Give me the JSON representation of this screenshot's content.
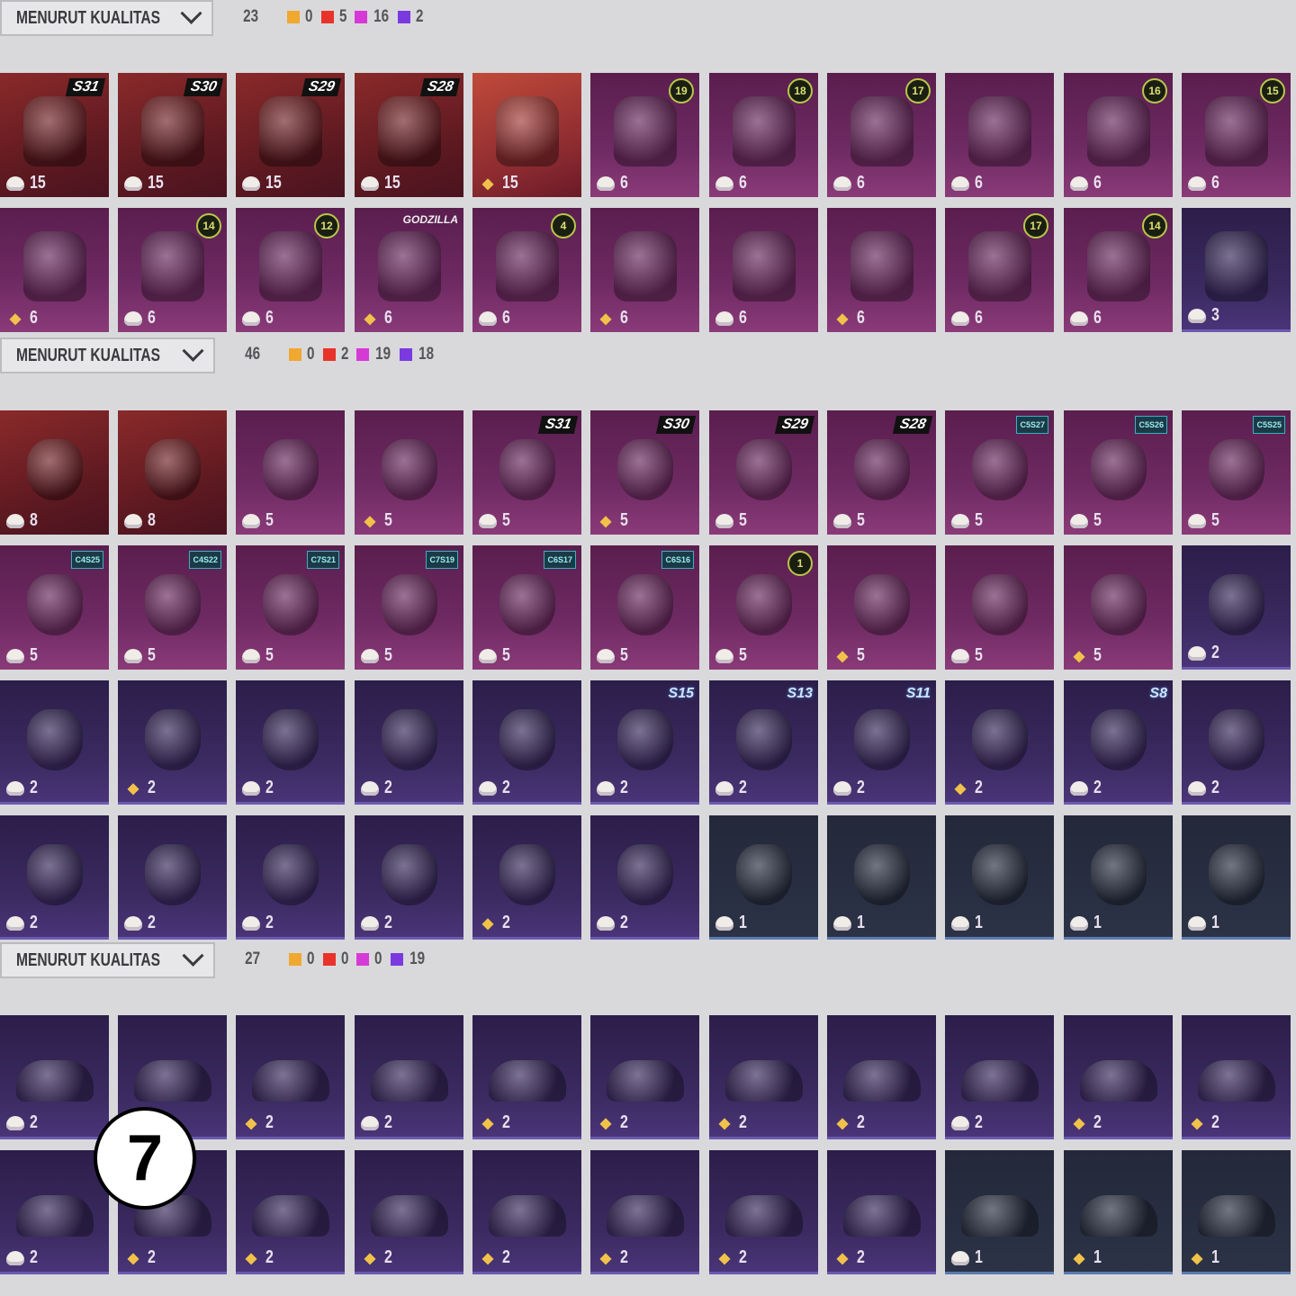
{
  "sections": [
    {
      "sort_label": "MENURUT KUALITAS",
      "total": "23",
      "qualities": [
        {
          "color": "#f0a830",
          "count": "0"
        },
        {
          "color": "#e8332a",
          "count": "5"
        },
        {
          "color": "#d63ad6",
          "count": "16"
        },
        {
          "color": "#7a3ae0",
          "count": "2"
        }
      ],
      "type": "bag",
      "rows": [
        [
          {
            "tone": "red",
            "badge": "S31",
            "btype": "season",
            "icon": "cloud-coin",
            "cost": "15"
          },
          {
            "tone": "red",
            "badge": "S30",
            "btype": "season",
            "icon": "cloud-coin",
            "cost": "15"
          },
          {
            "tone": "red",
            "badge": "S29",
            "btype": "season",
            "icon": "cloud-coin",
            "cost": "15"
          },
          {
            "tone": "red",
            "badge": "S28",
            "btype": "season",
            "icon": "cloud-coin",
            "cost": "15"
          },
          {
            "tone": "redhi",
            "badge": "",
            "btype": "",
            "icon": "gold-coin",
            "cost": "15"
          },
          {
            "tone": "pink",
            "badge": "19",
            "btype": "round",
            "icon": "cloud-coin",
            "cost": "6"
          },
          {
            "tone": "pink",
            "badge": "18",
            "btype": "round",
            "icon": "cloud-coin",
            "cost": "6"
          },
          {
            "tone": "pink",
            "badge": "17",
            "btype": "round",
            "icon": "cloud-coin",
            "cost": "6"
          },
          {
            "tone": "pink",
            "badge": "",
            "btype": "",
            "icon": "cloud-coin",
            "cost": "6"
          },
          {
            "tone": "pink",
            "badge": "16",
            "btype": "round",
            "icon": "cloud-coin",
            "cost": "6"
          },
          {
            "tone": "pink",
            "badge": "15",
            "btype": "round",
            "icon": "cloud-coin",
            "cost": "6"
          }
        ],
        [
          {
            "tone": "pink",
            "badge": "",
            "btype": "",
            "icon": "gold-coin",
            "cost": "6"
          },
          {
            "tone": "pink",
            "badge": "14",
            "btype": "round",
            "icon": "cloud-coin",
            "cost": "6"
          },
          {
            "tone": "pink",
            "badge": "12",
            "btype": "round",
            "icon": "cloud-coin",
            "cost": "6"
          },
          {
            "tone": "pink",
            "badge": "GODZILLA",
            "btype": "text",
            "icon": "gold-coin",
            "cost": "6"
          },
          {
            "tone": "pink",
            "badge": "4",
            "btype": "round",
            "icon": "cloud-coin",
            "cost": "6"
          },
          {
            "tone": "pink",
            "badge": "",
            "btype": "",
            "icon": "gold-coin",
            "cost": "6"
          },
          {
            "tone": "pink",
            "badge": "",
            "btype": "",
            "icon": "cloud-coin",
            "cost": "6"
          },
          {
            "tone": "pink",
            "badge": "",
            "btype": "",
            "icon": "gold-coin",
            "cost": "6"
          },
          {
            "tone": "pink",
            "badge": "17",
            "btype": "round",
            "icon": "cloud-coin",
            "cost": "6"
          },
          {
            "tone": "pink",
            "badge": "14",
            "btype": "round",
            "icon": "cloud-coin",
            "cost": "6"
          },
          {
            "tone": "purple",
            "badge": "",
            "btype": "",
            "icon": "cloud-coin",
            "cost": "3"
          }
        ]
      ]
    },
    {
      "sort_label": "MENURUT KUALITAS",
      "total": "46",
      "qualities": [
        {
          "color": "#f0a830",
          "count": "0"
        },
        {
          "color": "#e8332a",
          "count": "2"
        },
        {
          "color": "#d63ad6",
          "count": "19"
        },
        {
          "color": "#7a3ae0",
          "count": "18"
        }
      ],
      "type": "mask",
      "rows": [
        [
          {
            "tone": "red",
            "badge": "",
            "btype": "",
            "icon": "cloud-coin",
            "cost": "8"
          },
          {
            "tone": "red",
            "badge": "",
            "btype": "",
            "icon": "cloud-coin",
            "cost": "8"
          },
          {
            "tone": "pink",
            "badge": "",
            "btype": "",
            "icon": "cloud-coin",
            "cost": "5"
          },
          {
            "tone": "pink",
            "badge": "",
            "btype": "",
            "icon": "gold-coin",
            "cost": "5"
          },
          {
            "tone": "pink",
            "badge": "S31",
            "btype": "season",
            "icon": "cloud-coin",
            "cost": "5"
          },
          {
            "tone": "pink",
            "badge": "S30",
            "btype": "season",
            "icon": "gold-coin",
            "cost": "5"
          },
          {
            "tone": "pink",
            "badge": "S29",
            "btype": "season",
            "icon": "cloud-coin",
            "cost": "5"
          },
          {
            "tone": "pink",
            "badge": "S28",
            "btype": "season",
            "icon": "cloud-coin",
            "cost": "5"
          },
          {
            "tone": "pink",
            "badge": "C5S27",
            "btype": "hex",
            "icon": "cloud-coin",
            "cost": "5"
          },
          {
            "tone": "pink",
            "badge": "C5S26",
            "btype": "hex",
            "icon": "cloud-coin",
            "cost": "5"
          },
          {
            "tone": "pink",
            "badge": "C5S25",
            "btype": "hex",
            "icon": "cloud-coin",
            "cost": "5"
          }
        ],
        [
          {
            "tone": "pink",
            "badge": "C4S25",
            "btype": "hex",
            "icon": "cloud-coin",
            "cost": "5"
          },
          {
            "tone": "pink",
            "badge": "C4S22",
            "btype": "hex",
            "icon": "cloud-coin",
            "cost": "5"
          },
          {
            "tone": "pink",
            "badge": "C7S21",
            "btype": "hex",
            "icon": "cloud-coin",
            "cost": "5"
          },
          {
            "tone": "pink",
            "badge": "C7S19",
            "btype": "hex",
            "icon": "cloud-coin",
            "cost": "5"
          },
          {
            "tone": "pink",
            "badge": "C6S17",
            "btype": "hex",
            "icon": "cloud-coin",
            "cost": "5"
          },
          {
            "tone": "pink",
            "badge": "C6S16",
            "btype": "hex",
            "icon": "cloud-coin",
            "cost": "5"
          },
          {
            "tone": "pink",
            "badge": "1",
            "btype": "round",
            "icon": "cloud-coin",
            "cost": "5"
          },
          {
            "tone": "pink",
            "badge": "",
            "btype": "",
            "icon": "gold-coin",
            "cost": "5"
          },
          {
            "tone": "pink",
            "badge": "",
            "btype": "",
            "icon": "cloud-coin",
            "cost": "5"
          },
          {
            "tone": "pink",
            "badge": "",
            "btype": "",
            "icon": "gold-coin",
            "cost": "5"
          },
          {
            "tone": "purple",
            "badge": "",
            "btype": "",
            "icon": "cloud-coin",
            "cost": "2"
          }
        ],
        [
          {
            "tone": "purple",
            "badge": "",
            "btype": "",
            "icon": "cloud-coin",
            "cost": "2"
          },
          {
            "tone": "purple",
            "badge": "",
            "btype": "",
            "icon": "gold-coin",
            "cost": "2"
          },
          {
            "tone": "purple",
            "badge": "",
            "btype": "",
            "icon": "cloud-coin",
            "cost": "2"
          },
          {
            "tone": "purple",
            "badge": "",
            "btype": "",
            "icon": "cloud-coin",
            "cost": "2"
          },
          {
            "tone": "purple",
            "badge": "",
            "btype": "",
            "icon": "cloud-coin",
            "cost": "2"
          },
          {
            "tone": "purple",
            "badge": "S15",
            "btype": "wing",
            "icon": "cloud-coin",
            "cost": "2"
          },
          {
            "tone": "purple",
            "badge": "S13",
            "btype": "wing",
            "icon": "cloud-coin",
            "cost": "2"
          },
          {
            "tone": "purple",
            "badge": "S11",
            "btype": "wing",
            "icon": "cloud-coin",
            "cost": "2"
          },
          {
            "tone": "purple",
            "badge": "",
            "btype": "",
            "icon": "gold-coin",
            "cost": "2"
          },
          {
            "tone": "purple",
            "badge": "S8",
            "btype": "wing",
            "icon": "cloud-coin",
            "cost": "2"
          },
          {
            "tone": "purple",
            "badge": "",
            "btype": "",
            "icon": "cloud-coin",
            "cost": "2"
          }
        ],
        [
          {
            "tone": "purple",
            "badge": "",
            "btype": "",
            "icon": "cloud-coin",
            "cost": "2"
          },
          {
            "tone": "purple",
            "badge": "",
            "btype": "",
            "icon": "cloud-coin",
            "cost": "2"
          },
          {
            "tone": "purple",
            "badge": "",
            "btype": "",
            "icon": "cloud-coin",
            "cost": "2"
          },
          {
            "tone": "purple",
            "badge": "",
            "btype": "",
            "icon": "cloud-coin",
            "cost": "2"
          },
          {
            "tone": "purple",
            "badge": "",
            "btype": "",
            "icon": "gold-coin",
            "cost": "2"
          },
          {
            "tone": "purple",
            "badge": "",
            "btype": "",
            "icon": "cloud-coin",
            "cost": "2"
          },
          {
            "tone": "dark",
            "badge": "",
            "btype": "",
            "icon": "cloud-coin",
            "cost": "1"
          },
          {
            "tone": "dark",
            "badge": "",
            "btype": "",
            "icon": "cloud-coin",
            "cost": "1"
          },
          {
            "tone": "dark",
            "badge": "",
            "btype": "",
            "icon": "cloud-coin",
            "cost": "1"
          },
          {
            "tone": "dark",
            "badge": "",
            "btype": "",
            "icon": "cloud-coin",
            "cost": "1"
          },
          {
            "tone": "dark",
            "badge": "",
            "btype": "",
            "icon": "cloud-coin",
            "cost": "1"
          }
        ]
      ]
    },
    {
      "sort_label": "MENURUT KUALITAS",
      "total": "27",
      "qualities": [
        {
          "color": "#f0a830",
          "count": "0"
        },
        {
          "color": "#e8332a",
          "count": "0"
        },
        {
          "color": "#d63ad6",
          "count": "0"
        },
        {
          "color": "#7a3ae0",
          "count": "19"
        }
      ],
      "type": "shoe",
      "rows": [
        [
          {
            "tone": "purple",
            "badge": "",
            "btype": "",
            "icon": "cloud-coin",
            "cost": "2"
          },
          {
            "tone": "purple",
            "badge": "",
            "btype": "",
            "icon": "cloud-coin",
            "cost": "2"
          },
          {
            "tone": "purple",
            "badge": "",
            "btype": "",
            "icon": "gold-coin",
            "cost": "2"
          },
          {
            "tone": "purple",
            "badge": "",
            "btype": "",
            "icon": "cloud-coin",
            "cost": "2"
          },
          {
            "tone": "purple",
            "badge": "",
            "btype": "",
            "icon": "gold-coin",
            "cost": "2"
          },
          {
            "tone": "purple",
            "badge": "",
            "btype": "",
            "icon": "gold-coin",
            "cost": "2"
          },
          {
            "tone": "purple",
            "badge": "",
            "btype": "",
            "icon": "gold-coin",
            "cost": "2"
          },
          {
            "tone": "purple",
            "badge": "",
            "btype": "",
            "icon": "gold-coin",
            "cost": "2"
          },
          {
            "tone": "purple",
            "badge": "",
            "btype": "",
            "icon": "cloud-coin",
            "cost": "2"
          },
          {
            "tone": "purple",
            "badge": "",
            "btype": "",
            "icon": "gold-coin",
            "cost": "2"
          },
          {
            "tone": "purple",
            "badge": "",
            "btype": "",
            "icon": "gold-coin",
            "cost": "2"
          }
        ],
        [
          {
            "tone": "purple",
            "badge": "",
            "btype": "",
            "icon": "cloud-coin",
            "cost": "2"
          },
          {
            "tone": "purple",
            "badge": "",
            "btype": "",
            "icon": "gold-coin",
            "cost": "2"
          },
          {
            "tone": "purple",
            "badge": "",
            "btype": "",
            "icon": "gold-coin",
            "cost": "2"
          },
          {
            "tone": "purple",
            "badge": "",
            "btype": "",
            "icon": "gold-coin",
            "cost": "2"
          },
          {
            "tone": "purple",
            "badge": "",
            "btype": "",
            "icon": "gold-coin",
            "cost": "2"
          },
          {
            "tone": "purple",
            "badge": "",
            "btype": "",
            "icon": "gold-coin",
            "cost": "2"
          },
          {
            "tone": "purple",
            "badge": "",
            "btype": "",
            "icon": "gold-coin",
            "cost": "2"
          },
          {
            "tone": "purple",
            "badge": "",
            "btype": "",
            "icon": "gold-coin",
            "cost": "2"
          },
          {
            "tone": "dark",
            "badge": "",
            "btype": "",
            "icon": "cloud-coin",
            "cost": "1"
          },
          {
            "tone": "dark",
            "badge": "",
            "btype": "",
            "icon": "gold-coin",
            "cost": "1"
          },
          {
            "tone": "dark",
            "badge": "",
            "btype": "",
            "icon": "gold-coin",
            "cost": "1"
          }
        ]
      ]
    }
  ],
  "marker": "7"
}
